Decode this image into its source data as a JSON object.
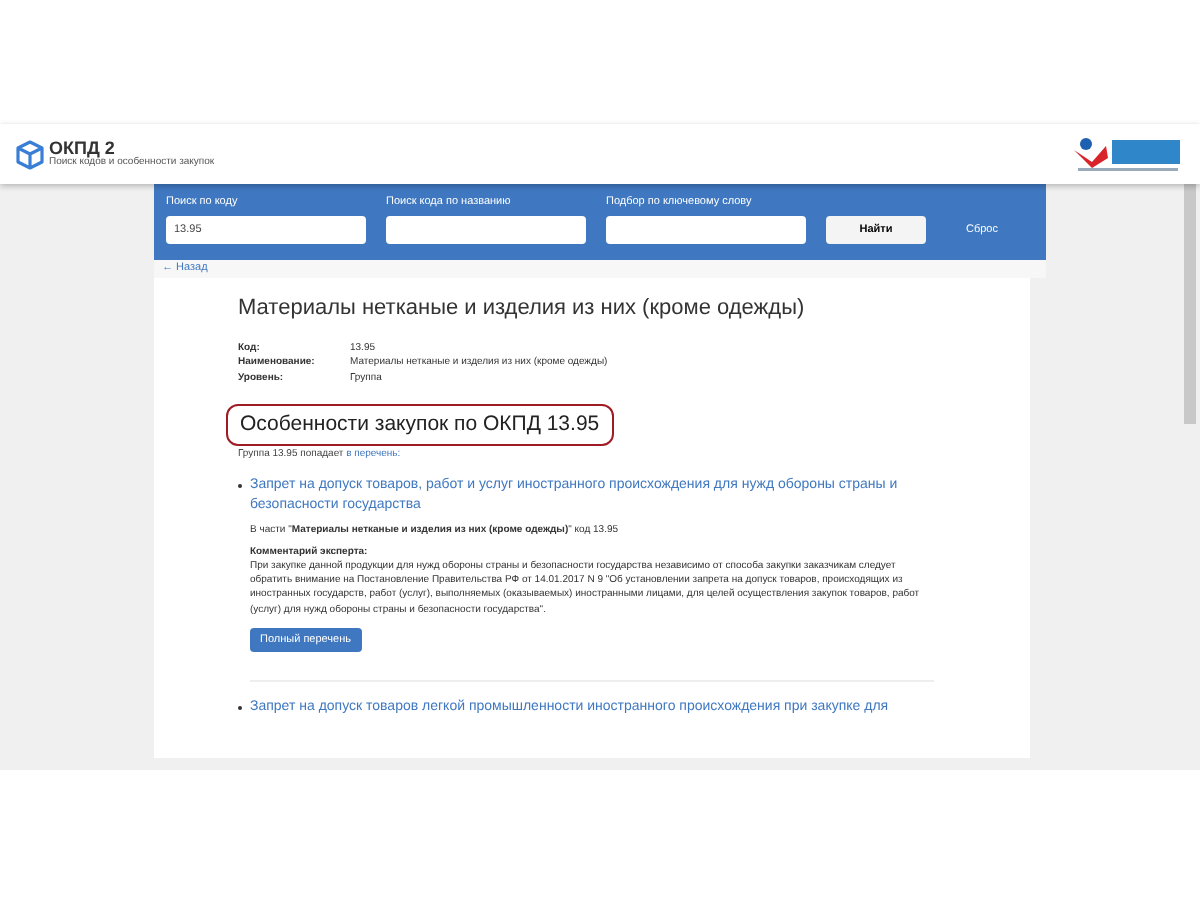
{
  "header": {
    "title": "ОКПД 2",
    "subtitle": "Поиск кодов и особенности закупок"
  },
  "search": {
    "fields": [
      {
        "label": "Поиск по коду",
        "value": "13.95"
      },
      {
        "label": "Поиск кода по названию"
      },
      {
        "label": "Подбор по ключевому слову"
      }
    ],
    "find_button": "Найти",
    "reset_link": "Сброс"
  },
  "back_link": "← Назад",
  "title": "Материалы нетканые и изделия из них (кроме одежды)",
  "details": [
    {
      "label": "Код:",
      "value": "13.95"
    },
    {
      "label": "Наименование:",
      "value": "Материалы нетканые и изделия из них (кроме одежды)"
    },
    {
      "label": "Уровень:",
      "value": "Группа"
    }
  ],
  "section_title": "Особенности закупок по ОКПД 13.95",
  "section_note": {
    "text": "Группа 13.95 попадает",
    "link": "в перечень:"
  },
  "items": [
    {
      "title": "Запрет на допуск товаров, работ и услуг иностранного происхождения для нужд обороны страны и безопасности государства",
      "part": "В части \"**Материалы нетканые и изделия из них (кроме одежды)**\" код 13.95",
      "comment_label": "Комментарий эксперта:",
      "comment": "При закупке данной продукции для нужд обороны страны и безопасности государства независимо от способа закупки заказчикам следует обратить внимание на Постановление Правительства РФ от 14.01.2017 N 9 \"Об установлении запрета на допуск товаров, происходящих из иностранных государств, работ (услуг), выполняемых (оказываемых) иностранными лицами, для целей осуществления закупок товаров, работ (услуг) для нужд обороны страны и безопасности государства\".",
      "button": "Полный перечень"
    },
    {
      "title": "Запрет на допуск товаров легкой промышленности иностранного происхождения при закупке для"
    }
  ]
}
